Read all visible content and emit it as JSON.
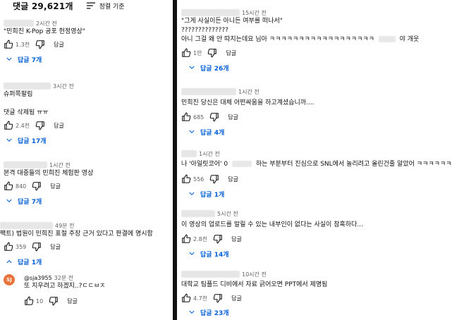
{
  "header": {
    "comment_count": "댓글 29,621개",
    "sort_label": "정렬 기준"
  },
  "reply_label": "답글",
  "left": [
    {
      "time": "2시간 전",
      "lines": [
        "\"민희진 K-Pop 공포 헌정영상\""
      ],
      "likes": "1.3천",
      "replies": "답글 7개"
    },
    {
      "time": "3시간 전",
      "lines": [
        "슈퍼쪽팔림",
        "",
        "댓글 삭제됨 ㅠㅠ"
      ],
      "likes": "2.4천",
      "replies": "답글 17개"
    },
    {
      "time": "1시간 전",
      "lines": [
        "본격 대중들의 민희진 체험판 영상"
      ],
      "likes": "840",
      "replies": "답글 7개"
    },
    {
      "time": "49분 전",
      "lines": [
        "팩트) 법원이 민희진 표절 주장 근거 있다고 판결에 명시함"
      ],
      "likes": "359",
      "replies": "답글 1개"
    }
  ],
  "reply_item": {
    "avatar": "SJ",
    "author": "@sja3955",
    "time": "32분 전",
    "text": "또 지우려고 하겠지..?ㄷㄷㅂㅈ",
    "likes": "10"
  },
  "right": [
    {
      "time": "15시간 전",
      "lines": [
        "\"그게 사실이든 아니든 여부를 떠나서\"",
        "??????????????"
      ],
      "line3a": "아니 그걸 왜 안 따지는데요 님아 ㅋㅋㅋㅋㅋㅋㅋㅋㅋㅋㅋㅋㅋㅋㅋㅋㅋㅋ",
      "line3b": "야 개웃",
      "likes": "1만",
      "replies": "답글 26개"
    },
    {
      "time": "1시간 전",
      "lines": [
        "민희진 당신은 대체 어떤싸움을 하고계셨습니까...."
      ],
      "likes": "685",
      "replies": "답글 4개"
    },
    {
      "time": "1시간 전",
      "line1a": "나 '아일릿코어' 0",
      "line1b": "하는 부분부터 진심으로 SNL에서 놀리려고 올린건줄 알았어 ㅋㅋㅋㅋㅋㅋ",
      "likes": "556",
      "replies": "답글 1개"
    },
    {
      "time": "5시간 전",
      "lines": [
        "이 영상의 업로드를 말릴 수 있는 내부인이 없다는 사실이 참혹하다..."
      ],
      "likes": "2.8천",
      "replies": "답글 14개"
    },
    {
      "time": "10시간 전",
      "lines": [
        "대학교 팀플드 디비에서 자료 긁어오면 PPT에서 제명됨"
      ],
      "likes": "4.7천",
      "replies": "답글 23개"
    }
  ]
}
